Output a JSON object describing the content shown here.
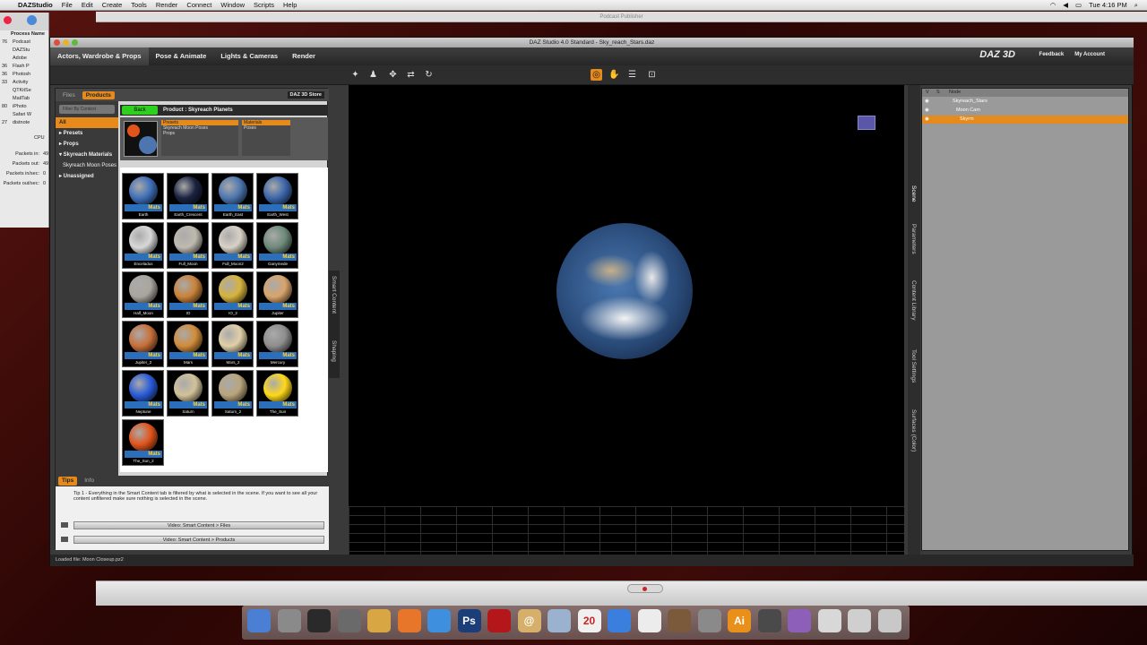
{
  "menubar": {
    "apple": "",
    "app": "DAZStudio",
    "items": [
      "File",
      "Edit",
      "Create",
      "Tools",
      "Render",
      "Connect",
      "Window",
      "Scripts",
      "Help"
    ],
    "clock": "Tue 4:16 PM"
  },
  "activity": {
    "header": "Process Name",
    "rows": [
      {
        "pid": "76",
        "name": "Podcast"
      },
      {
        "pid": "",
        "name": "DAZStu"
      },
      {
        "pid": "",
        "name": "Adobe"
      },
      {
        "pid": "36",
        "name": "Flash P"
      },
      {
        "pid": "36",
        "name": "Photosh"
      },
      {
        "pid": "33",
        "name": "Activity"
      },
      {
        "pid": "",
        "name": "QTKitSe"
      },
      {
        "pid": "",
        "name": "MailTab"
      },
      {
        "pid": "80",
        "name": "iPhoto"
      },
      {
        "pid": "",
        "name": "Safari W"
      },
      {
        "pid": "27",
        "name": "distnote"
      }
    ],
    "cpu_label": "CPU",
    "stats": [
      {
        "label": "Packets in:",
        "value": "49"
      },
      {
        "label": "Packets out:",
        "value": "49"
      },
      {
        "label": "Packets in/sec:",
        "value": "0"
      },
      {
        "label": "Packets out/sec:",
        "value": "0"
      }
    ]
  },
  "podcast_window": {
    "title": "Podcast Publisher"
  },
  "daz": {
    "title": "DAZ Studio 4.0 Standard - Sky_reach_Stars.daz",
    "rooms": [
      "Actors, Wardrobe & Props",
      "Pose & Animate",
      "Lights & Cameras",
      "Render"
    ],
    "logo": "DAZ 3D",
    "links": [
      "Feedback",
      "My Account"
    ],
    "smart_content": {
      "tabs": [
        "Files",
        "Products"
      ],
      "store": "DAZ 3D Store",
      "dropdown": "Filter By Context",
      "categories": [
        {
          "label": "All",
          "active": true,
          "sub": false
        },
        {
          "label": "▸ Presets",
          "active": false,
          "sub": false
        },
        {
          "label": "▸ Props",
          "active": false,
          "sub": false
        },
        {
          "label": "▾ Skyreach Materials",
          "active": false,
          "sub": false
        },
        {
          "label": "Skyreach Moon Poses",
          "active": false,
          "sub": true
        },
        {
          "label": "▸ Unassigned",
          "active": false,
          "sub": false
        }
      ],
      "back": "Back",
      "product": "Product : Skyreach Planets",
      "list1": {
        "header": "Presets",
        "items": [
          "Skyreach Moon Poses",
          "Props"
        ]
      },
      "list2": {
        "header": "Materials",
        "items": [
          "Poses"
        ]
      },
      "mats_label": "Mats",
      "tiles": [
        {
          "label": "Earth",
          "color": "#3e6fb8"
        },
        {
          "label": "Earth_Crescent",
          "color": "#1a2240"
        },
        {
          "label": "Earth_East",
          "color": "#4d76b0"
        },
        {
          "label": "Earth_West",
          "color": "#3c66aa"
        },
        {
          "label": "Enceladus",
          "color": "#d8d8d8"
        },
        {
          "label": "Full_Moon",
          "color": "#bfbab0"
        },
        {
          "label": "Full_Moon2",
          "color": "#d8d2c6"
        },
        {
          "label": "Ganymede",
          "color": "#6e8a7a"
        },
        {
          "label": "Half_Moon",
          "color": "#a9a69f"
        },
        {
          "label": "IO",
          "color": "#c9823a"
        },
        {
          "label": "IO_2",
          "color": "#d7b33c"
        },
        {
          "label": "Jupiter",
          "color": "#d9a46b"
        },
        {
          "label": "Jupiter_2",
          "color": "#c8703a"
        },
        {
          "label": "Mars",
          "color": "#d18c3a"
        },
        {
          "label": "Mars_2",
          "color": "#e1cfa8"
        },
        {
          "label": "Mercury",
          "color": "#8e8e8e"
        },
        {
          "label": "Neptune",
          "color": "#2a5bd8"
        },
        {
          "label": "Saturn",
          "color": "#d2c19a"
        },
        {
          "label": "Saturn_2",
          "color": "#b9a57c"
        },
        {
          "label": "The_Sun",
          "color": "#ffd81a"
        },
        {
          "label": "The_Sun_2",
          "color": "#e2541b"
        }
      ],
      "tips_tabs": [
        "Tips",
        "Info"
      ],
      "tip": "Tip 1 - Everything in the Smart Content tab is filtered by what is selected in the scene. If you want to see all your content unfiltered make sure nothing is selected in the scene.",
      "videos": [
        "Video: Smart Content > Files",
        "Video: Smart Content > Products"
      ],
      "side_tabs": [
        "Smart Content",
        "Shaping"
      ]
    },
    "right_tabs": [
      "Scene",
      "Parameters",
      "Content Library",
      "Tool Settings",
      "Surfaces (Color)"
    ],
    "scene": {
      "header": [
        "V",
        "S",
        "Node"
      ],
      "nodes": [
        {
          "label": "Skyreach_Stars",
          "selected": false
        },
        {
          "label": "Moon Cam",
          "selected": false
        },
        {
          "label": "Skyrm",
          "selected": true
        }
      ]
    },
    "status": "Loaded file: Moon Closeup.pz2"
  },
  "dock": {
    "items": [
      {
        "name": "finder-icon",
        "label": "",
        "color": "#4a7fd4"
      },
      {
        "name": "launchpad-icon",
        "label": "",
        "color": "#8a8a8a"
      },
      {
        "name": "activity-monitor-icon",
        "label": "",
        "color": "#2a2a2a"
      },
      {
        "name": "system-icon",
        "label": "",
        "color": "#6a6a6a"
      },
      {
        "name": "folder-icon",
        "label": "",
        "color": "#d9a644"
      },
      {
        "name": "firefox-icon",
        "label": "",
        "color": "#e8762a"
      },
      {
        "name": "safari-icon",
        "label": "",
        "color": "#3f8fdf"
      },
      {
        "name": "photoshop-icon",
        "label": "Ps",
        "color": "#1b3d78"
      },
      {
        "name": "photo-booth-icon",
        "label": "",
        "color": "#b3171a"
      },
      {
        "name": "address-book-icon",
        "label": "@",
        "color": "#d6b06a"
      },
      {
        "name": "mail-icon",
        "label": "",
        "color": "#9ab2d0"
      },
      {
        "name": "calendar-icon",
        "label": "20",
        "color": "#f0f0f0"
      },
      {
        "name": "itunes-icon",
        "label": "",
        "color": "#3a7fdd"
      },
      {
        "name": "textedit-icon",
        "label": "",
        "color": "#ececec"
      },
      {
        "name": "preview-icon",
        "label": "",
        "color": "#7a5a3a"
      },
      {
        "name": "system-preferences-icon",
        "label": "",
        "color": "#8a8a8a"
      },
      {
        "name": "illustrator-icon",
        "label": "Ai",
        "color": "#e8901a"
      },
      {
        "name": "daz-icon",
        "label": "",
        "color": "#4a4a4a"
      },
      {
        "name": "podcast-icon",
        "label": "",
        "color": "#8e5fb8"
      },
      {
        "name": "display-icon",
        "label": "",
        "color": "#d8d8d8"
      },
      {
        "name": "usb-icon",
        "label": "",
        "color": "#cfcfcf"
      },
      {
        "name": "trash-icon",
        "label": "",
        "color": "#c8c8c8"
      }
    ]
  }
}
